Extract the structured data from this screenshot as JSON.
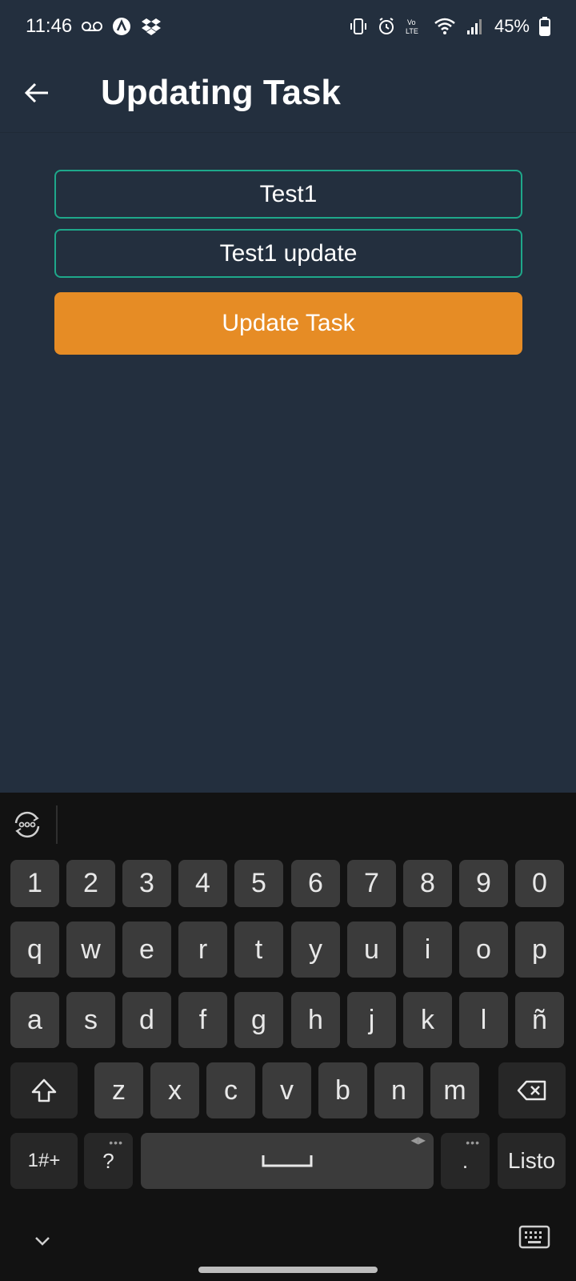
{
  "status_bar": {
    "time": "11:46",
    "battery_pct": "45%",
    "icons_left": [
      "voicemail-icon",
      "a-circle-icon",
      "dropbox-icon"
    ],
    "icons_right": [
      "vibrate-icon",
      "alarm-icon",
      "volte-icon",
      "wifi-icon",
      "signal-icon",
      "battery-icon"
    ]
  },
  "app_bar": {
    "title": "Updating Task",
    "back_icon": "arrow-left-icon"
  },
  "form": {
    "field1_value": "Test1",
    "field2_value": "Test1 update",
    "button_label": "Update Task"
  },
  "colors": {
    "background": "#232f3e",
    "accent_border": "#1ea88a",
    "button": "#e68c25",
    "keyboard_bg": "#121212"
  },
  "keyboard": {
    "row_numbers": [
      "1",
      "2",
      "3",
      "4",
      "5",
      "6",
      "7",
      "8",
      "9",
      "0"
    ],
    "row1": [
      "q",
      "w",
      "e",
      "r",
      "t",
      "y",
      "u",
      "i",
      "o",
      "p"
    ],
    "row2": [
      "a",
      "s",
      "d",
      "f",
      "g",
      "h",
      "j",
      "k",
      "l",
      "ñ"
    ],
    "row3": [
      "z",
      "x",
      "c",
      "v",
      "b",
      "n",
      "m"
    ],
    "symbols_key": "1#+",
    "question_key": "?",
    "period_key": ".",
    "done_key": "Listo"
  }
}
